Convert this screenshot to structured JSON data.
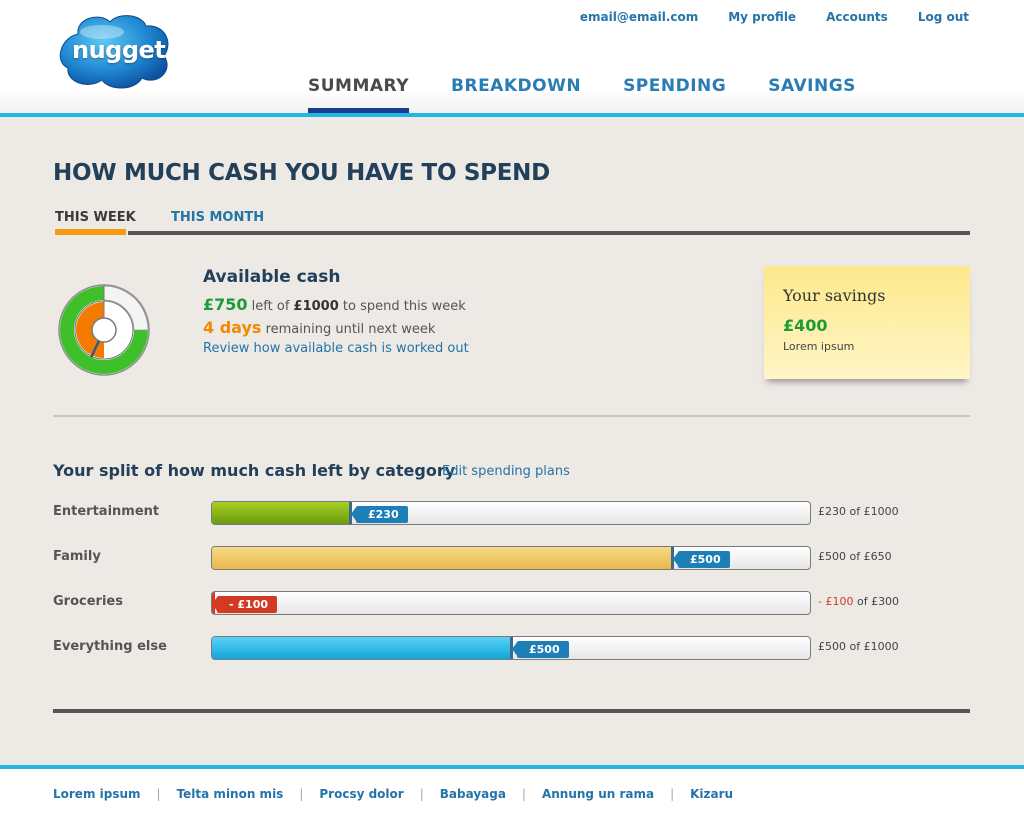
{
  "brand": {
    "logo_text": "nugget"
  },
  "top_links": {
    "email": "email@email.com",
    "profile": "My profile",
    "accounts": "Accounts",
    "logout": "Log out"
  },
  "main_nav": {
    "summary": "SUMMARY",
    "breakdown": "BREAKDOWN",
    "spending": "SPENDING",
    "savings": "SAVINGS",
    "active": "SUMMARY"
  },
  "page": {
    "title": "HOW MUCH CASH YOU HAVE TO SPEND"
  },
  "period_tabs": {
    "this_week": "THIS WEEK",
    "this_month": "THIS MONTH",
    "active": "THIS WEEK"
  },
  "available": {
    "title": "Available cash",
    "amount_left": "£750",
    "left_of": "left of",
    "total": "£1000",
    "to_spend": "to spend this week",
    "days": "4 days",
    "remaining_text": "remaining until next week",
    "review_link": "Review how available cash is worked out",
    "chart": {
      "remaining_fraction": 0.75,
      "days_fraction": 0.57
    }
  },
  "savings_note": {
    "title": "Your savings",
    "amount": "£400",
    "subtext": "Lorem ipsum"
  },
  "split": {
    "title": "Your split of how much cash left by category",
    "edit_link": "Edit spending plans",
    "categories": [
      {
        "name": "Entertainment",
        "tag": "£230",
        "summary_amount": "£230",
        "summary_rest": "of £1000",
        "color": "#8ab81a",
        "fraction": 0.23,
        "negative": false
      },
      {
        "name": "Family",
        "tag": "£500",
        "summary_amount": "£500",
        "summary_rest": "of £650",
        "color": "#f0c566",
        "fraction": 0.77,
        "negative": false
      },
      {
        "name": "Groceries",
        "tag": "- £100",
        "summary_amount": "- £100",
        "summary_rest": "of £300",
        "color": "#d23a24",
        "fraction": 0.0,
        "negative": true
      },
      {
        "name": "Everything else",
        "tag": "£500",
        "summary_amount": "£500",
        "summary_rest": "of £1000",
        "color": "#18aee2",
        "fraction": 0.5,
        "negative": false
      }
    ]
  },
  "footer": {
    "links": [
      "Lorem ipsum",
      "Telta minon mis",
      "Procsy dolor",
      "Babayaga",
      "Annung un rama",
      "Kizaru"
    ]
  }
}
